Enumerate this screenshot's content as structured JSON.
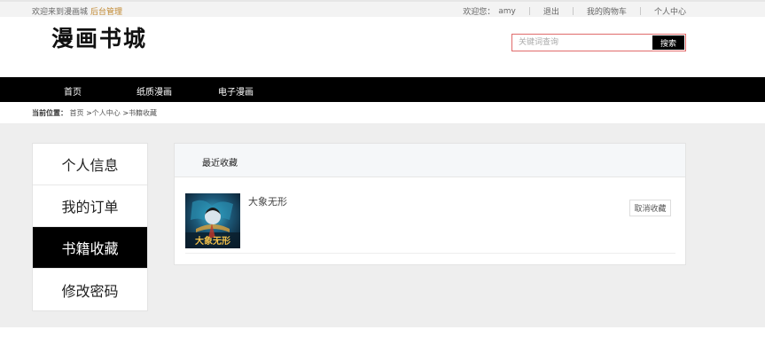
{
  "topbar": {
    "welcome": "欢迎来到漫画城",
    "admin": "后台管理",
    "greeting": "欢迎您：",
    "username": "amy",
    "logout": "退出",
    "cart": "我的购物车",
    "account": "个人中心"
  },
  "header": {
    "logo": "漫画书城",
    "search_placeholder": "关键词查询",
    "search_button": "搜索"
  },
  "nav": {
    "items": [
      "首页",
      "纸质漫画",
      "电子漫画"
    ]
  },
  "breadcrumb": {
    "prefix": "当前位置：",
    "home": "首页",
    "center": "个人中心",
    "current": "书籍收藏",
    "separator": ">"
  },
  "sidebar": {
    "items": [
      {
        "label": "个人信息",
        "active": false
      },
      {
        "label": "我的订单",
        "active": false
      },
      {
        "label": "书籍收藏",
        "active": true
      },
      {
        "label": "修改密码",
        "active": false
      }
    ]
  },
  "main": {
    "title": "最近收藏",
    "favorites": [
      {
        "title": "大象无形",
        "cancel_label": "取消收藏",
        "cover_text": "大象无形"
      }
    ]
  },
  "colors": {
    "accent": "#000000",
    "admin_link": "#c0872e",
    "search_border": "#e06b6b",
    "content_bg": "#eeeeee"
  }
}
